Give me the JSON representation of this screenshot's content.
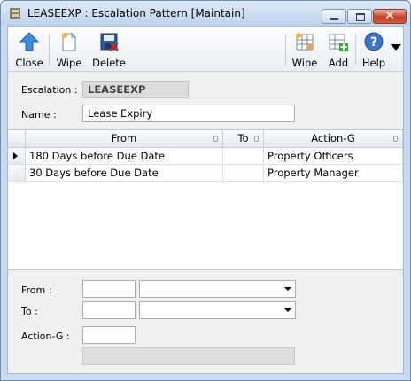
{
  "window": {
    "title": "LEASEEXP : Escalation Pattern [Maintain]"
  },
  "toolbar": {
    "close_label": "Close",
    "wipe_label": "Wipe",
    "delete_label": "Delete",
    "grid_wipe_label": "Wipe",
    "add_label": "Add",
    "help_label": "Help"
  },
  "header": {
    "escalation_label": "Escalation :",
    "escalation_value": "LEASEEXP",
    "name_label": "Name :",
    "name_value": "Lease Expiry"
  },
  "grid": {
    "columns": [
      "From",
      "To",
      "Action-G"
    ],
    "rows": [
      {
        "from": "180 Days before Due Date",
        "to": "",
        "action": "Property Officers"
      },
      {
        "from": "30 Days before Due Date",
        "to": "",
        "action": "Property Manager"
      }
    ]
  },
  "detail": {
    "from_label": "From :",
    "to_label": "To :",
    "action_label": "Action-G :"
  },
  "colors": {
    "titlebar": "#c9dcf1",
    "close_button": "#c8432a",
    "help_icon": "#3b76c9"
  }
}
